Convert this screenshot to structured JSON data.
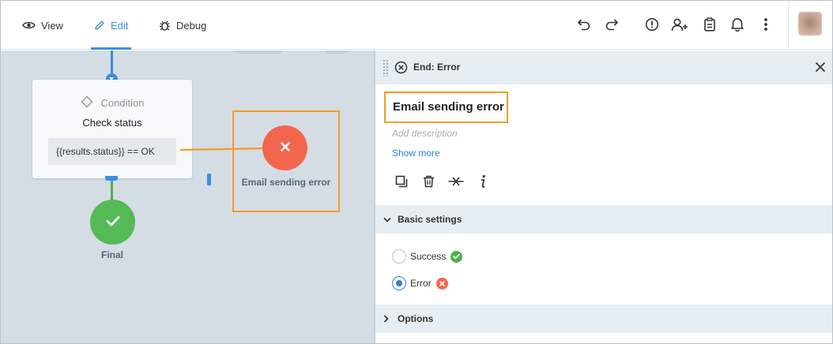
{
  "toolbar": {
    "modes": [
      {
        "label": "View",
        "icon": "eye-icon"
      },
      {
        "label": "Edit",
        "icon": "pencil-icon",
        "active": true
      },
      {
        "label": "Debug",
        "icon": "bug-icon"
      }
    ],
    "actions": [
      "undo-icon",
      "redo-icon",
      "alert-circle-icon",
      "add-user-icon",
      "clipboard-icon",
      "bell-icon",
      "more-vertical-icon"
    ],
    "accent": "#3a8ee6"
  },
  "canvas": {
    "condition_node": {
      "type_label": "Condition",
      "title": "Check status",
      "expression": "{{results.status}} == OK"
    },
    "final_node": {
      "label": "Final",
      "color": "#55b956"
    },
    "error_node": {
      "label": "Email sending error",
      "color": "#f2664d"
    },
    "highlight_color": "#f59b26"
  },
  "panel": {
    "header_title": "End: Error",
    "name": "Email sending error",
    "description_placeholder": "Add description",
    "show_more": "Show more",
    "actions": [
      "duplicate-icon",
      "trash-icon",
      "disconnect-icon",
      "info-icon"
    ],
    "basic_settings": {
      "label": "Basic settings",
      "expanded": true,
      "options": [
        {
          "label": "Success",
          "checked": false,
          "badge_color": "#4caf50"
        },
        {
          "label": "Error",
          "checked": true,
          "badge_color": "#f2664d"
        }
      ]
    },
    "options_section": {
      "label": "Options",
      "expanded": false
    }
  }
}
